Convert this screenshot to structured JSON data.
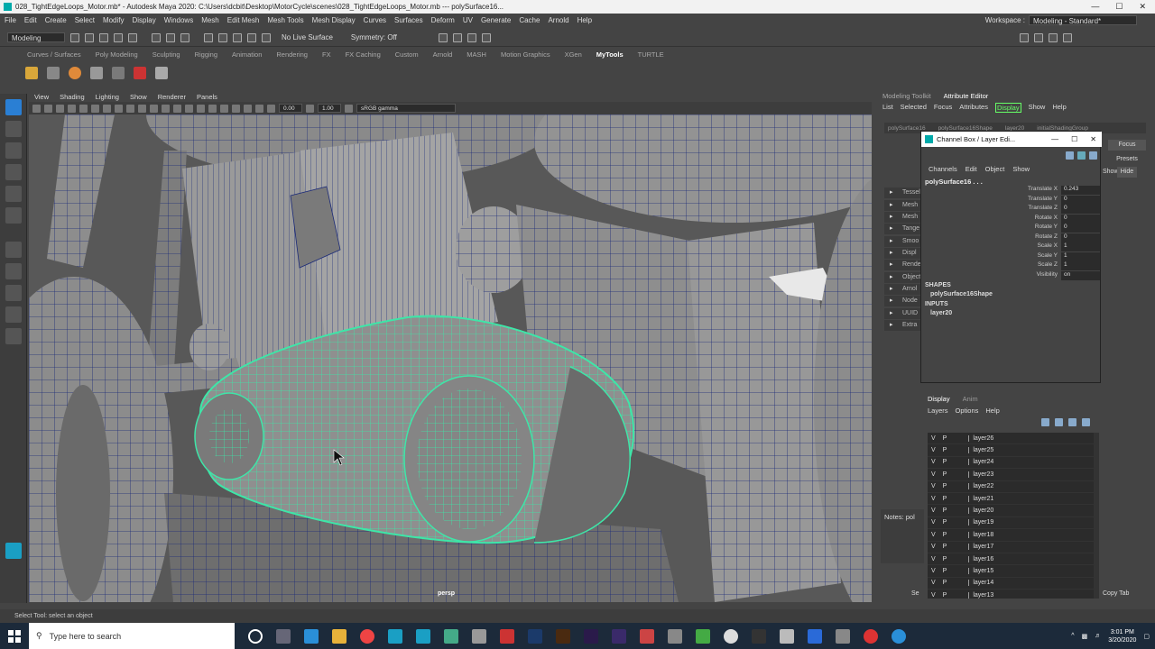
{
  "window": {
    "title": "028_TightEdgeLoops_Motor.mb* - Autodesk Maya 2020: C:\\Users\\dcbit\\Desktop\\MotorCycle\\scenes\\028_TightEdgeLoops_Motor.mb   ---   polySurface16...",
    "controls": [
      "—",
      "☐",
      "✕"
    ]
  },
  "menubar": [
    "File",
    "Edit",
    "Create",
    "Select",
    "Modify",
    "Display",
    "Windows",
    "Mesh",
    "Edit Mesh",
    "Mesh Tools",
    "Mesh Display",
    "Curves",
    "Surfaces",
    "Deform",
    "UV",
    "Generate",
    "Cache",
    "Arnold",
    "Help"
  ],
  "workspace": {
    "label": "Workspace :",
    "value": "Modeling - Standard*"
  },
  "statusline": {
    "mode": "Modeling",
    "live_surface": "No Live Surface",
    "symmetry": "Symmetry: Off"
  },
  "shelf_tabs": [
    "Curves / Surfaces",
    "Poly Modeling",
    "Sculpting",
    "Rigging",
    "Animation",
    "Rendering",
    "FX",
    "FX Caching",
    "Custom",
    "Arnold",
    "MASH",
    "Motion Graphics",
    "XGen",
    "MyTools",
    "TURTLE"
  ],
  "shelf_active": "MyTools",
  "viewport": {
    "menu": [
      "View",
      "Shading",
      "Lighting",
      "Show",
      "Renderer",
      "Panels"
    ],
    "cam_value1": "0.00",
    "cam_value2": "1.00",
    "color_space": "sRGB gamma",
    "camera_label": "persp"
  },
  "attr_editor": {
    "tabs": [
      "Modeling Toolkit",
      "Attribute Editor"
    ],
    "menu": [
      "List",
      "Selected",
      "Focus",
      "Attributes",
      "Display",
      "Show",
      "Help"
    ],
    "highlight": "Display",
    "node_tabs": [
      "polySurface16",
      "polySurface16Shape",
      "layer20",
      "initialShadingGroup"
    ],
    "focus": "Focus",
    "presets": "Presets",
    "show": "Show",
    "hide": "Hide",
    "sections": [
      "Tessel",
      "Mesh",
      "Mesh",
      "Tange",
      "Smoo",
      "Displ",
      "Rende",
      "Object",
      "Arnol",
      "Node",
      "UUID",
      "Extra"
    ],
    "notes_label": "Notes: pol",
    "bottom_buttons": [
      "Se",
      "Copy Tab"
    ]
  },
  "channel_box": {
    "title": "Channel Box / Layer Edi...",
    "menu": [
      "Channels",
      "Edit",
      "Object",
      "Show"
    ],
    "object": "polySurface16 . . .",
    "attributes": [
      {
        "name": "Translate X",
        "value": "0.243"
      },
      {
        "name": "Translate Y",
        "value": "0"
      },
      {
        "name": "Translate Z",
        "value": "0"
      },
      {
        "name": "Rotate X",
        "value": "0"
      },
      {
        "name": "Rotate Y",
        "value": "0"
      },
      {
        "name": "Rotate Z",
        "value": "0"
      },
      {
        "name": "Scale X",
        "value": "1"
      },
      {
        "name": "Scale Y",
        "value": "1"
      },
      {
        "name": "Scale Z",
        "value": "1"
      },
      {
        "name": "Visibility",
        "value": "on"
      }
    ],
    "shapes_label": "SHAPES",
    "shape": "polySurface16Shape",
    "inputs_label": "INPUTS",
    "input": "layer20"
  },
  "layer_editor": {
    "tabs": [
      "Display",
      "Anim"
    ],
    "menu": [
      "Layers",
      "Options",
      "Help"
    ],
    "layers": [
      {
        "v": "V",
        "p": "P",
        "name": "layer26"
      },
      {
        "v": "V",
        "p": "P",
        "name": "layer25"
      },
      {
        "v": "V",
        "p": "P",
        "name": "layer24"
      },
      {
        "v": "V",
        "p": "P",
        "name": "layer23"
      },
      {
        "v": "V",
        "p": "P",
        "name": "layer22"
      },
      {
        "v": "V",
        "p": "P",
        "name": "layer21"
      },
      {
        "v": "V",
        "p": "P",
        "name": "layer20"
      },
      {
        "v": "V",
        "p": "P",
        "name": "layer19"
      },
      {
        "v": "V",
        "p": "P",
        "name": "layer18"
      },
      {
        "v": "V",
        "p": "P",
        "name": "layer17"
      },
      {
        "v": "V",
        "p": "P",
        "name": "layer16"
      },
      {
        "v": "V",
        "p": "P",
        "name": "layer15"
      },
      {
        "v": "V",
        "p": "P",
        "name": "layer14"
      },
      {
        "v": "V",
        "p": "P",
        "name": "layer13"
      }
    ]
  },
  "helpline": "Select Tool: select an object",
  "taskbar": {
    "search_placeholder": "Type here to search",
    "time": "3:01 PM",
    "date": "3/20/2020"
  },
  "colors": {
    "selection": "#3ee6a8",
    "wire": "#1b2a78",
    "panel": "#444444",
    "accent": "#2a7fd4"
  }
}
